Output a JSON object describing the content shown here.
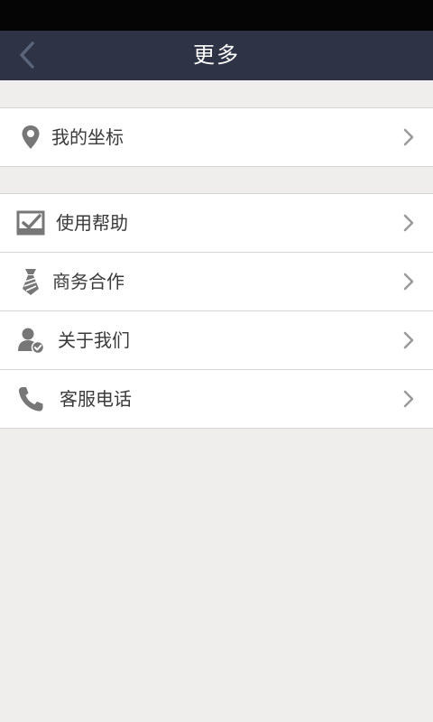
{
  "header": {
    "title": "更多",
    "back_icon": "back-chevron-icon"
  },
  "groups": [
    {
      "items": [
        {
          "label": "我的坐标",
          "icon": "location-pin-icon"
        }
      ]
    },
    {
      "items": [
        {
          "label": "使用帮助",
          "icon": "help-checkbox-icon"
        },
        {
          "label": "商务合作",
          "icon": "necktie-icon"
        },
        {
          "label": "关于我们",
          "icon": "user-verified-icon"
        },
        {
          "label": "客服电话",
          "icon": "phone-icon"
        }
      ]
    }
  ],
  "colors": {
    "title_bar": "#2e3446",
    "status_bar": "#050505",
    "background": "#efeeec",
    "icon": "#777777",
    "chevron": "#9a9a9a"
  }
}
